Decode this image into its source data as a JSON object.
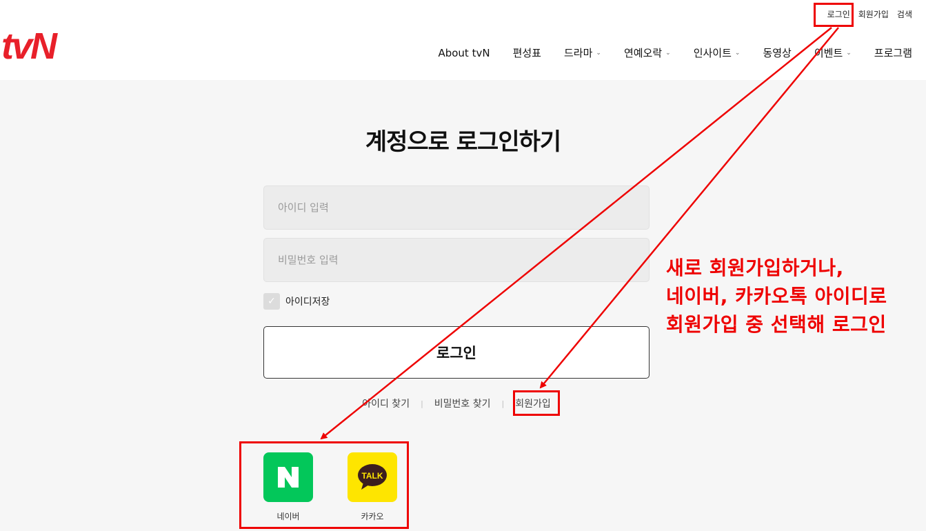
{
  "header": {
    "logo": "tvN",
    "util": {
      "login": "로그인",
      "signup": "회원가입",
      "search": "검색"
    },
    "menu": [
      {
        "label": "About tvN",
        "dropdown": false
      },
      {
        "label": "편성표",
        "dropdown": false
      },
      {
        "label": "드라마",
        "dropdown": true
      },
      {
        "label": "연예오락",
        "dropdown": true
      },
      {
        "label": "인사이트",
        "dropdown": true
      },
      {
        "label": "동영상",
        "dropdown": false
      },
      {
        "label": "이벤트",
        "dropdown": true
      },
      {
        "label": "프로그램",
        "dropdown": false
      }
    ]
  },
  "login": {
    "title": "계정으로 로그인하기",
    "id_placeholder": "아이디 입력",
    "pw_placeholder": "비밀번호 입력",
    "save_id": "아이디저장",
    "save_id_checked": false,
    "button": "로그인",
    "links": {
      "find_id": "아이디 찾기",
      "find_pw": "비밀번호 찾기",
      "signup": "회원가입"
    }
  },
  "social": {
    "naver": {
      "label": "네이버",
      "color": "#03c75a"
    },
    "kakao": {
      "label": "카카오",
      "color": "#fee500"
    }
  },
  "annotation": {
    "lines": [
      "새로 회원가입하거나,",
      "네이버, 카카오톡 아이디로",
      "회원가입 중 선택해 로그인"
    ],
    "color": "#ee0000"
  }
}
